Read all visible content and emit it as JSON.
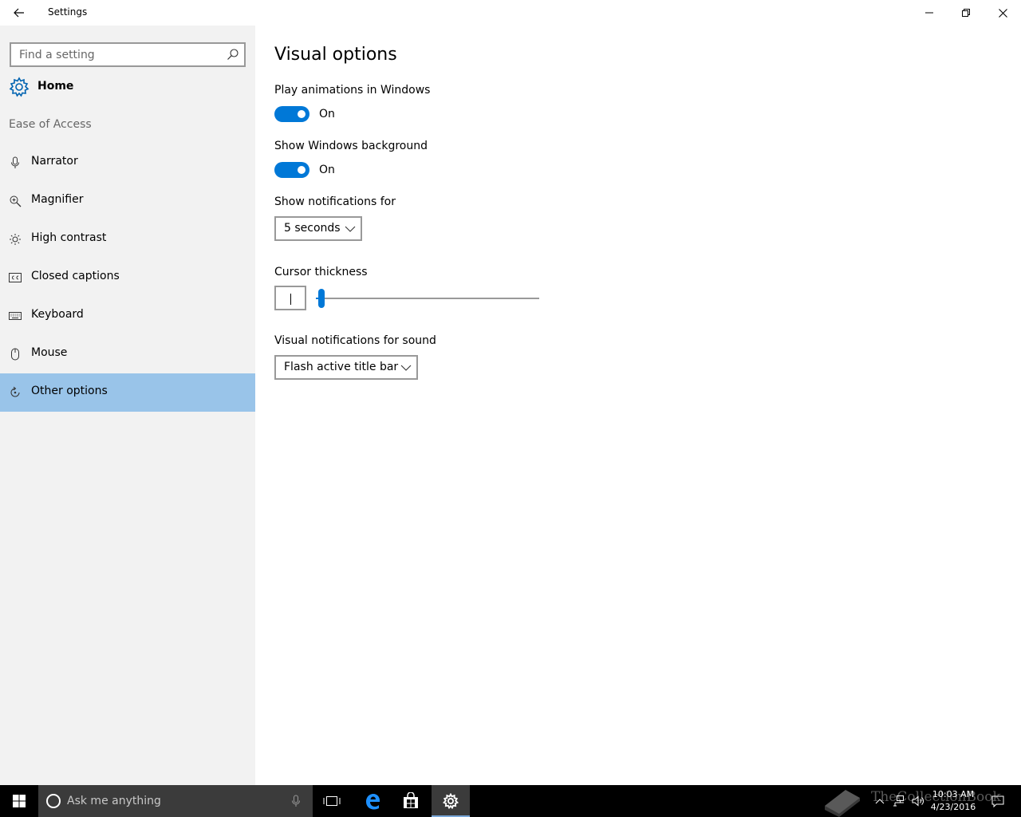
{
  "window": {
    "title": "Settings"
  },
  "sidebar": {
    "search_placeholder": "Find a setting",
    "home_label": "Home",
    "section_label": "Ease of Access",
    "items": [
      {
        "label": "Narrator",
        "icon": "microphone-icon"
      },
      {
        "label": "Magnifier",
        "icon": "magnifier-icon"
      },
      {
        "label": "High contrast",
        "icon": "sun-icon"
      },
      {
        "label": "Closed captions",
        "icon": "closed-captions-icon"
      },
      {
        "label": "Keyboard",
        "icon": "keyboard-icon"
      },
      {
        "label": "Mouse",
        "icon": "mouse-icon"
      },
      {
        "label": "Other options",
        "icon": "refresh-icon",
        "selected": true
      }
    ]
  },
  "main": {
    "title": "Visual options",
    "play_animations": {
      "label": "Play animations in Windows",
      "state": "On"
    },
    "show_background": {
      "label": "Show Windows background",
      "state": "On"
    },
    "notifications": {
      "label": "Show notifications for",
      "value": "5 seconds"
    },
    "cursor_thickness": {
      "label": "Cursor thickness",
      "level": 0.01
    },
    "visual_sound": {
      "label": "Visual notifications for sound",
      "value": "Flash active title bar"
    }
  },
  "taskbar": {
    "search_text": "Ask me anything",
    "time": "10:03 AM",
    "date": "4/23/2016",
    "watermark": "TheCollectionBook"
  },
  "colors": {
    "accent": "#0078d7",
    "selected_nav": "#99c4e9",
    "sidebar_bg": "#f2f2f2",
    "taskbar_bg": "#000000"
  }
}
